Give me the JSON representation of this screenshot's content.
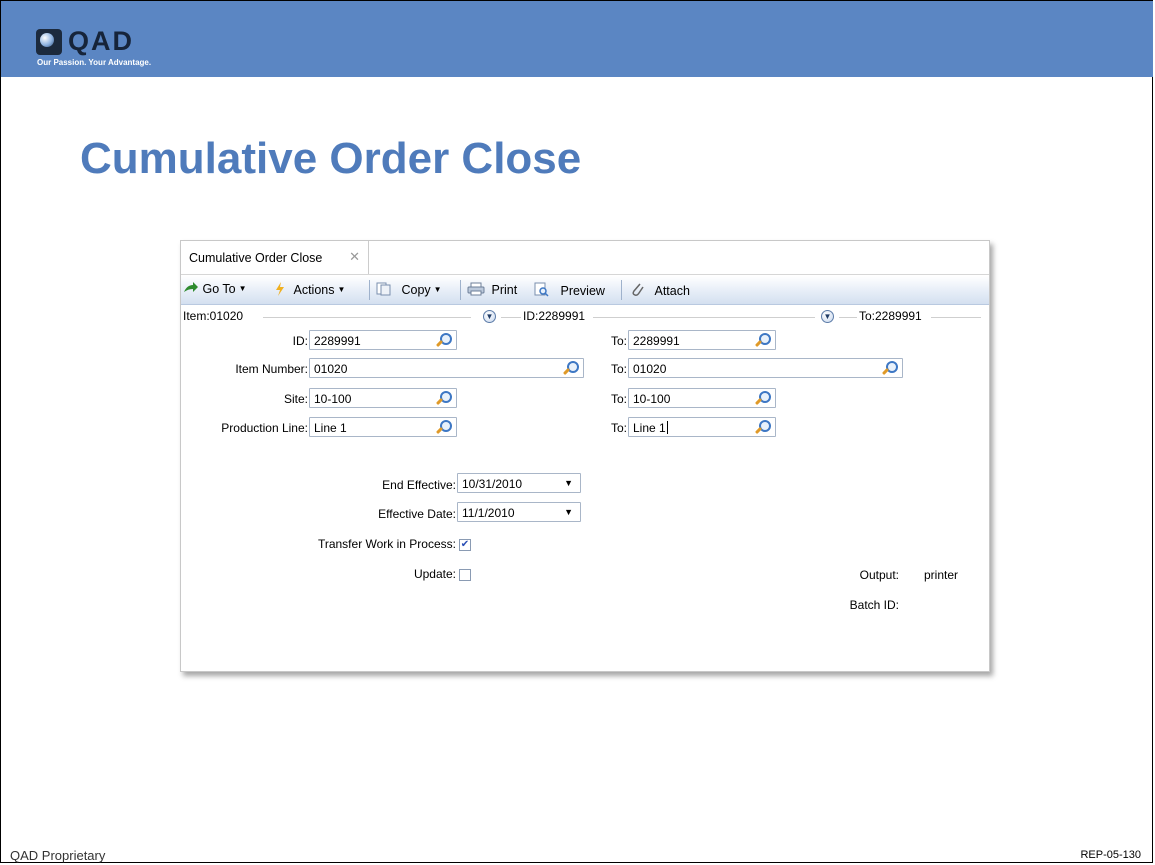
{
  "slide": {
    "title": "Cumulative Order Close",
    "footer_left": "QAD Proprietary",
    "footer_right": "REP-05-130",
    "banner_color": "#5b86c3",
    "title_color": "#4f7bbb"
  },
  "logo": {
    "text": "QAD",
    "tagline": "Our Passion. Your Advantage."
  },
  "window": {
    "tab_label": "Cumulative Order Close",
    "toolbar": {
      "goto": "Go To",
      "actions": "Actions",
      "copy": "Copy",
      "print": "Print",
      "preview": "Preview",
      "attach": "Attach"
    },
    "sections": {
      "item": "Item:01020",
      "id": "ID:2289991",
      "to": "To:2289991"
    },
    "form": {
      "id_label": "ID:",
      "id_value": "2289991",
      "item_number_label": "Item Number:",
      "item_number_value": "01020",
      "site_label": "Site:",
      "site_value": "10-100",
      "production_line_label": "Production Line:",
      "production_line_value": "Line 1",
      "to_label": "To:",
      "to_id_value": "2289991",
      "to_item_value": "01020",
      "to_site_value": "10-100",
      "to_line_value": "Line 1",
      "end_effective_label": "End Effective:",
      "end_effective_value": "10/31/2010",
      "effective_date_label": "Effective Date:",
      "effective_date_value": "11/1/2010",
      "transfer_wip_label": "Transfer Work in Process:",
      "transfer_wip_checked": true,
      "update_label": "Update:",
      "update_checked": false,
      "output_label": "Output:",
      "output_value": "printer",
      "batch_id_label": "Batch ID:"
    }
  }
}
